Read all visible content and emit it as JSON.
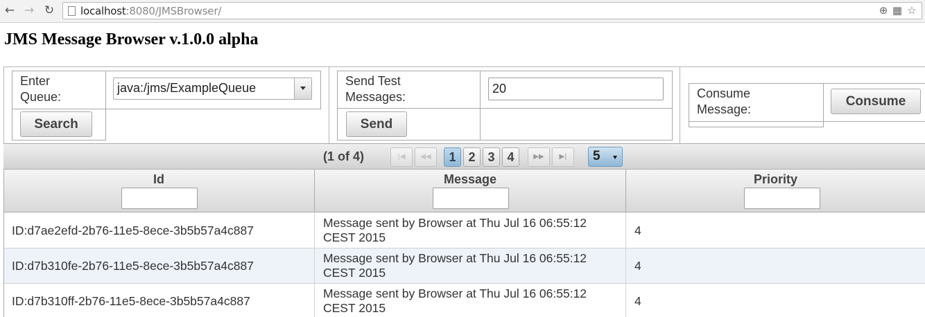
{
  "browser": {
    "url_host": "localhost",
    "url_rest": ":8080/JMSBrowser/",
    "icons": [
      "back-icon",
      "forward-icon",
      "reload-icon",
      "page-icon",
      "zoom-icon",
      "translate-icon",
      "bookmark-star-icon"
    ]
  },
  "page": {
    "title": "JMS Message Browser v.1.0.0 alpha"
  },
  "queue_form": {
    "label_line1": "Enter",
    "label_line2": "Queue:",
    "selected_queue": "java:/jms/ExampleQueue",
    "search_label": "Search"
  },
  "send_form": {
    "label_line1": "Send Test",
    "label_line2": "Messages:",
    "count_value": "20",
    "send_label": "Send"
  },
  "consume_form": {
    "label_line1": "Consume",
    "label_line2": "Message:",
    "consume_label": "Consume"
  },
  "paginator": {
    "current_text": "(1 of 4)",
    "pages": [
      "1",
      "2",
      "3",
      "4"
    ],
    "active_page": "1",
    "rows_per_page": "5"
  },
  "table": {
    "columns": [
      "Id",
      "Message",
      "Priority"
    ],
    "rows": [
      {
        "id": "ID:d7ae2efd-2b76-11e5-8ece-3b5b57a4c887",
        "message_line1": "Message sent by Browser at Thu Jul 16 06:55:12",
        "message_line2": "CEST 2015",
        "priority": "4"
      },
      {
        "id": "ID:d7b310fe-2b76-11e5-8ece-3b5b57a4c887",
        "message_line1": "Message sent by Browser at Thu Jul 16 06:55:12",
        "message_line2": "CEST 2015",
        "priority": "4"
      },
      {
        "id": "ID:d7b310ff-2b76-11e5-8ece-3b5b57a4c887",
        "message_line1": "Message sent by Browser at Thu Jul 16 06:55:12",
        "message_line2": "CEST 2015",
        "priority": "4"
      }
    ]
  }
}
